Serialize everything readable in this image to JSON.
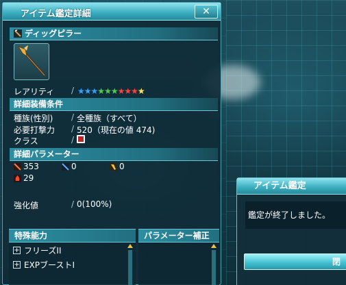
{
  "window": {
    "title": "アイテム鑑定詳細",
    "close_label": "✕"
  },
  "item": {
    "name": "ディッグピラー",
    "icon": "partisan-weapon-icon"
  },
  "rarity": {
    "label": "レアリティ",
    "stars": 9,
    "star_colors": [
      "#3aa0ff",
      "#3aa0ff",
      "#3aa0ff",
      "#4ad14a",
      "#4ad14a",
      "#4ad14a",
      "#ff4040",
      "#ff4040",
      "#ff4040"
    ],
    "extra_star_color": "#ffe566"
  },
  "requirements": {
    "header": "詳細装備条件",
    "race_label": "種族(性別)",
    "race_value": "全種族（すべて）",
    "atk_label": "必要打撃力",
    "atk_value": "520（現在の値 474)",
    "class_label": "クラス",
    "class_icon": "hunter-class-icon"
  },
  "params": {
    "header": "詳細パラメーター",
    "melee": "353",
    "ranged": "0",
    "tech": "0",
    "element": "29"
  },
  "grind": {
    "label": "強化値",
    "value": "0(100%)"
  },
  "abilities": {
    "header": "特殊能力",
    "items": [
      "フリーズII",
      "EXPブーストI"
    ]
  },
  "param_bonus": {
    "header": "パラメーター補正"
  },
  "dialog": {
    "title": "アイテム鑑定",
    "message": "鑑定が終了しました。",
    "button": "閉"
  }
}
